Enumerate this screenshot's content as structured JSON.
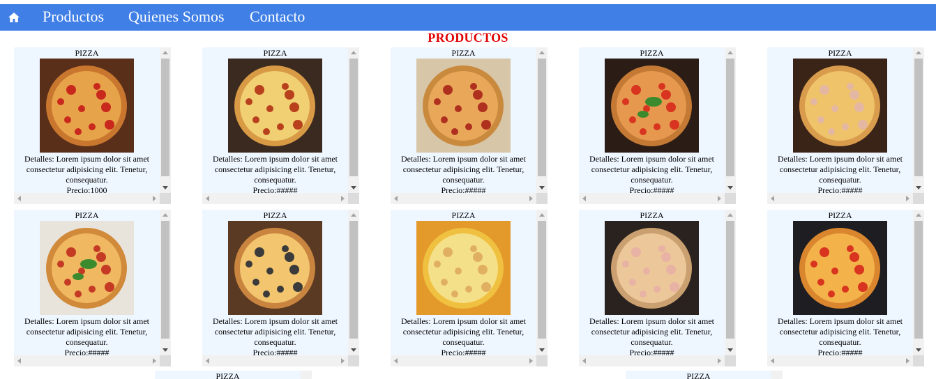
{
  "nav": {
    "home_icon": "home-icon",
    "links": [
      "Productos",
      "Quienes Somos",
      "Contacto"
    ]
  },
  "page_title": "PRODUCTOS",
  "products": [
    {
      "name": "PIZZA",
      "detail": "Detalles: Lorem ipsum dolor sit amet consectetur adipisicing elit. Tenetur, consequatur.",
      "price": "Precio:1000"
    },
    {
      "name": "PIZZA",
      "detail": "Detalles: Lorem ipsum dolor sit amet consectetur adipisicing elit. Tenetur, consequatur.",
      "price": "Precio:#####"
    },
    {
      "name": "PIZZA",
      "detail": "Detalles: Lorem ipsum dolor sit amet consectetur adipisicing elit. Tenetur, consequatur.",
      "price": "Precio:#####"
    },
    {
      "name": "PIZZA",
      "detail": "Detalles: Lorem ipsum dolor sit amet consectetur adipisicing elit. Tenetur, consequatur.",
      "price": "Precio:#####"
    },
    {
      "name": "PIZZA",
      "detail": "Detalles: Lorem ipsum dolor sit amet consectetur adipisicing elit. Tenetur, consequatur.",
      "price": "Precio:#####"
    },
    {
      "name": "PIZZA",
      "detail": "Detalles: Lorem ipsum dolor sit amet consectetur adipisicing elit. Tenetur, consequatur.",
      "price": "Precio:#####"
    },
    {
      "name": "PIZZA",
      "detail": "Detalles: Lorem ipsum dolor sit amet consectetur adipisicing elit. Tenetur, consequatur.",
      "price": "Precio:#####"
    },
    {
      "name": "PIZZA",
      "detail": "Detalles: Lorem ipsum dolor sit amet consectetur adipisicing elit. Tenetur, consequatur.",
      "price": "Precio:#####"
    },
    {
      "name": "PIZZA",
      "detail": "Detalles: Lorem ipsum dolor sit amet consectetur adipisicing elit. Tenetur, consequatur.",
      "price": "Precio:#####"
    },
    {
      "name": "PIZZA",
      "detail": "Detalles: Lorem ipsum dolor sit amet consectetur adipisicing elit. Tenetur, consequatur.",
      "price": "Precio:#####"
    }
  ],
  "partial_products": [
    {
      "name": "PIZZA"
    },
    {
      "name": "PIZZA"
    }
  ],
  "colors": {
    "navbar": "#3f7fe6",
    "title": "#e10000",
    "card_bg": "#eef6ff"
  }
}
